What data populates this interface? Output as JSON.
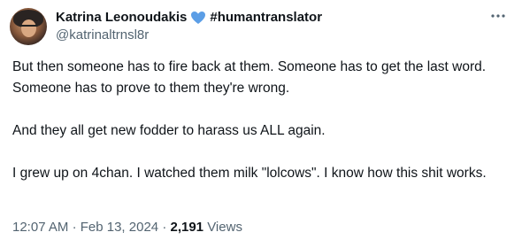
{
  "author": {
    "name": "Katrina Leonoudakis",
    "heart_icon": "blue-heart-icon",
    "hashtag": "#humantranslator",
    "handle": "@katrinaltrnsl8r"
  },
  "more_icon": "more-options-icon",
  "tweet": {
    "paragraphs": [
      "But then someone has to fire back at them. Someone has to get the last word. Someone has to prove to them they're wrong.",
      "And they all get new fodder to harass us ALL again.",
      "I grew up on 4chan. I watched them milk \"lolcows\". I know how this shit works."
    ]
  },
  "meta": {
    "time": "12:07 AM",
    "separator1": "·",
    "date": "Feb 13, 2024",
    "separator2": "·",
    "views_count": "2,191",
    "views_label": "Views"
  },
  "colors": {
    "heart": "#5b9ee6",
    "muted": "#536471",
    "text": "#0f1419"
  }
}
